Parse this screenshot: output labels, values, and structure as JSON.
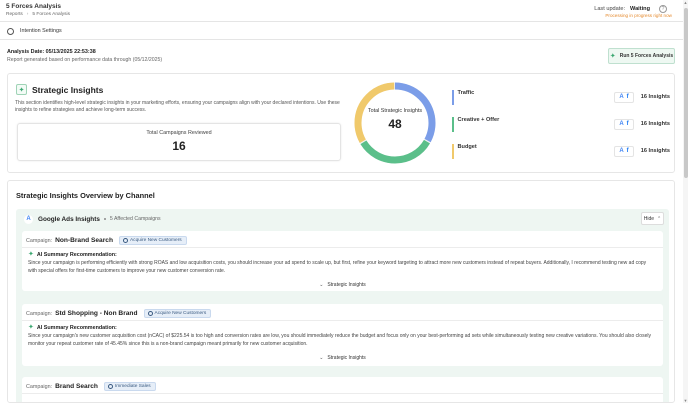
{
  "header": {
    "title": "5 Forces Analysis",
    "breadcrumb": [
      "Reports",
      "5 Forces Analysis"
    ],
    "last_update_label": "Last update:",
    "last_update_status": "Waiting",
    "processing_text": "Processing in progress right now",
    "help_icon": "question-icon"
  },
  "settings": {
    "label": "Intention Settings",
    "icon": "gear-icon"
  },
  "analysis": {
    "date_text": "Analysis Date: 05/13/2025 22:53:38",
    "generated_text": "Report generated based on performance data through (05/12/2025)",
    "run_button": "Run 5 Forces Analysis"
  },
  "strategic": {
    "title": "Strategic Insights",
    "description": "This section identifies high-level strategic insights in your marketing efforts, ensuring your campaigns align with your declared intentions. Use these insights to refine strategies and achieve long-term success.",
    "campaigns_label": "Total Campaigns Reviewed",
    "campaigns_value": "16",
    "donut_label": "Total Strategic Insights",
    "donut_value": "48",
    "categories": [
      {
        "name": "Traffic",
        "count": "16 Insights",
        "color": "#7b9de8",
        "value": 16
      },
      {
        "name": "Creative + Offer",
        "count": "16 Insights",
        "color": "#5bbf8a",
        "value": 16
      },
      {
        "name": "Budget",
        "count": "16 Insights",
        "color": "#f0c96b",
        "value": 16
      }
    ]
  },
  "overview": {
    "title": "Strategic Insights Overview by Channel",
    "channel": {
      "name": "Google Ads Insights",
      "affected": "5 Affected Campaigns",
      "hide_label": "Hide"
    },
    "campaign_label": "Campaign:",
    "ai_title": "AI Summary Recommendation:",
    "insights_toggle": "Strategic Insights",
    "campaigns": [
      {
        "name": "Non-Brand Search",
        "tag": "Acquire New Customers",
        "text": "Since your campaign is performing efficiently with strong ROAS and low acquisition costs, you should increase your ad spend to scale up, but first, refine your keyword targeting to attract more new customers instead of repeat buyers. Additionally, I recommend testing new ad copy with special offers for first-time customers to improve your new customer conversion rate."
      },
      {
        "name": "Std Shopping - Non Brand",
        "tag": "Acquire New Customers",
        "text": "Since your campaign's new customer acquisition cost (nCAC) of $225.54 is too high and conversion rates are low, you should immediately reduce the budget and focus only on your best-performing ad sets while simultaneously testing new creative variations. You should also closely monitor your repeat customer rate of 45.45% since this is a non-brand campaign meant primarily for new customer acquisition."
      },
      {
        "name": "Brand Search",
        "tag": "Immediate Sales",
        "text": ""
      }
    ]
  }
}
